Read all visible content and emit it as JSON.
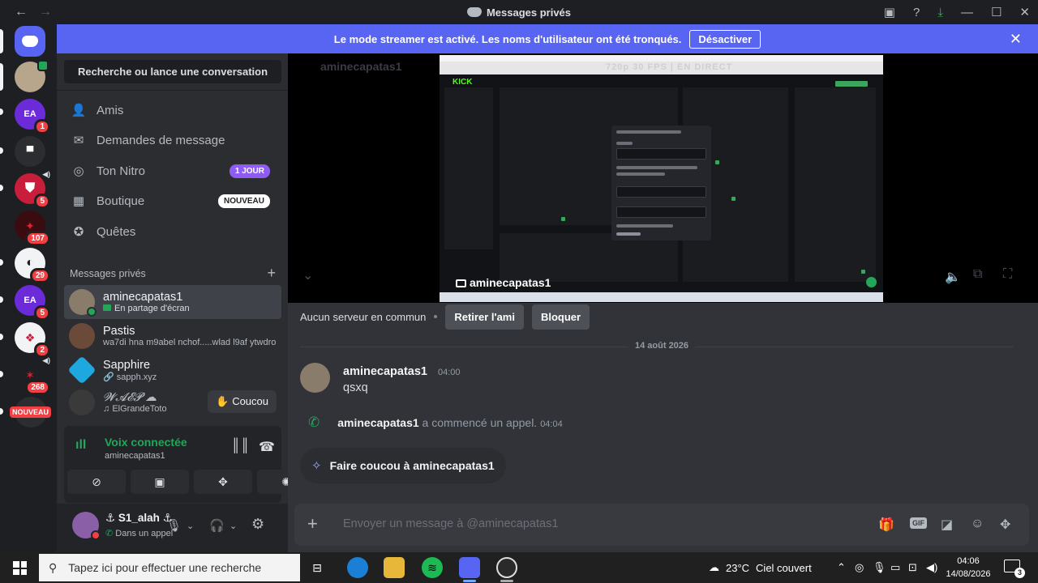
{
  "window": {
    "title": "Messages privés",
    "back_glyph": "←",
    "forward_glyph": "→",
    "controls": [
      "inbox-icon",
      "help-icon",
      "download-icon",
      "minimize-icon",
      "maximize-icon",
      "close-icon"
    ]
  },
  "banner": {
    "text": "Le mode streamer est activé. Les noms d'utilisateur ont été tronqués.",
    "button": "Désactiver",
    "close": "✕"
  },
  "servers": [
    {
      "name": "discord-home",
      "badge": ""
    },
    {
      "name": "avatar-server",
      "badge": ""
    },
    {
      "name": "ea-server-1",
      "label": "EA",
      "badge": "1"
    },
    {
      "name": "monitor-server",
      "badge": ""
    },
    {
      "name": "shield-server",
      "badge": "5"
    },
    {
      "name": "server-107",
      "badge": "107"
    },
    {
      "name": "server-29",
      "badge": "29"
    },
    {
      "name": "ea-server-5",
      "label": "EA",
      "badge": "5"
    },
    {
      "name": "wolf-server",
      "badge": "2"
    },
    {
      "name": "server-268",
      "badge": "268"
    },
    {
      "name": "new-server",
      "label": "NOUVEAU",
      "badge": ""
    }
  ],
  "sidebar": {
    "search": "Recherche ou lance une conversation",
    "nav": [
      {
        "label": "Amis",
        "icon": "friends-icon",
        "glyph": "👤",
        "tag": ""
      },
      {
        "label": "Demandes de message",
        "icon": "mail-icon",
        "glyph": "✉",
        "tag": ""
      },
      {
        "label": "Ton Nitro",
        "icon": "nitro-icon",
        "glyph": "◎",
        "tag": "1 JOUR"
      },
      {
        "label": "Boutique",
        "icon": "shop-icon",
        "glyph": "▦",
        "tag": "NOUVEAU"
      },
      {
        "label": "Quêtes",
        "icon": "quests-icon",
        "glyph": "✪",
        "tag": ""
      }
    ],
    "dm_header": "Messages privés",
    "dm_add": "+",
    "dms": [
      {
        "name": "aminecapatas1",
        "sub": "En partage d'écran",
        "status": "#23a55a",
        "avatar": "#8a7c6a"
      },
      {
        "name": "Pastis",
        "sub": "wa7di hna m9abel nchof.....wlad l9af ytwdro",
        "status": "",
        "avatar": "#6b4a3a"
      },
      {
        "name": "Sapphire",
        "sub": "sapph.xyz",
        "status": "",
        "avatar": "#1ea8e0"
      },
      {
        "name": "𝓦𝓐𝓔𝓟 ☁",
        "sub": "ElGrandeToto",
        "status": "",
        "avatar": "#3a3a3a",
        "wave": "Coucou"
      }
    ]
  },
  "voice": {
    "status": "Voix connectée",
    "channel": "aminecapatas1"
  },
  "user": {
    "name": "⚓ S1_alah ⚓",
    "status": "Dans un appel"
  },
  "stream": {
    "overlay_text": "720p 30 FPS | EN DIRECT",
    "site_label": "KICK",
    "streamer_label": "aminecapatas1",
    "ghost_name": "aminecapatas1"
  },
  "relationship": {
    "text": "Aucun serveur en commun",
    "remove": "Retirer l'ami",
    "block": "Bloquer"
  },
  "chat": {
    "date": "14 août 2026",
    "message": {
      "author": "aminecapatas1",
      "time": "04:00",
      "text": "qsxq"
    },
    "call": {
      "author": "aminecapatas1",
      "text": "a commencé un appel.",
      "time": "04:04"
    },
    "wave_card": "Faire coucou à aminecapatas1"
  },
  "composer": {
    "placeholder": "Envoyer un message à @aminecapatas1",
    "gif": "GIF"
  },
  "taskbar": {
    "search_placeholder": "Tapez ici pour effectuer une recherche",
    "temperature": "23°C",
    "weather": "Ciel couvert",
    "time": "04:06",
    "date": "14/08/2026",
    "notifications": "3"
  },
  "colors": {
    "accent": "#5865f2",
    "online": "#23a55a",
    "danger": "#f23f43",
    "kick_green": "#53fc18"
  }
}
